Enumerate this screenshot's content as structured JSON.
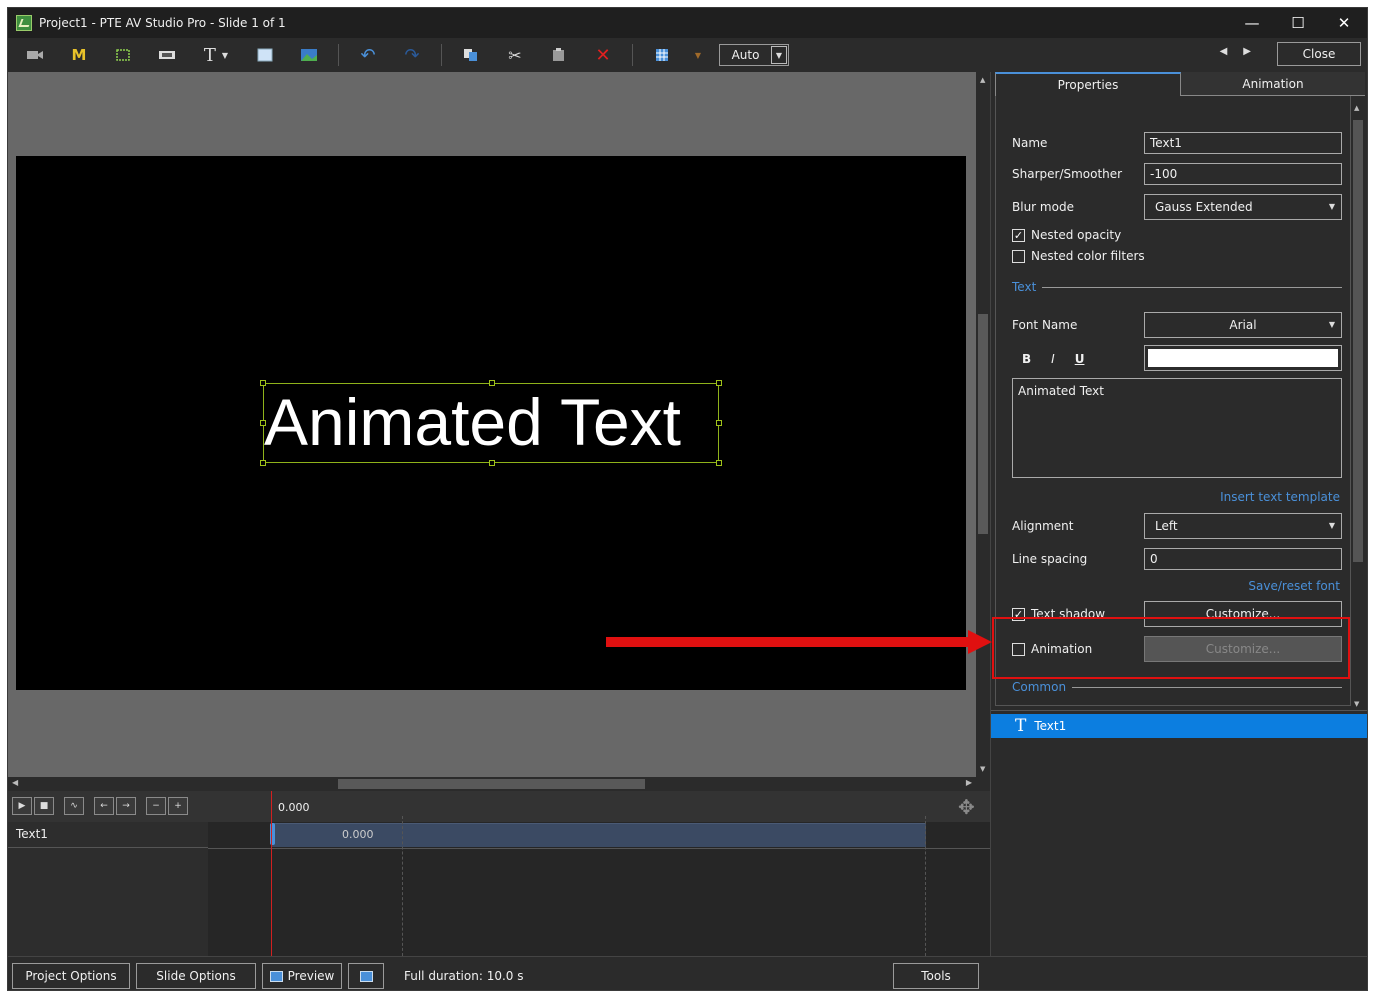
{
  "window": {
    "title": "Project1 - PTE AV Studio Pro - Slide 1 of 1",
    "minimize_glyph": "—",
    "maximize_glyph": "☐",
    "close_glyph": "✕"
  },
  "toolbar": {
    "text_tool_label": "T",
    "mask_tool_label": "M",
    "zoom_value": "Auto",
    "close_label": "Close"
  },
  "canvas": {
    "text_object": "Animated Text"
  },
  "tabs": {
    "properties": "Properties",
    "animation": "Animation"
  },
  "properties": {
    "name_label": "Name",
    "name_value": "Text1",
    "sharper_label": "Sharper/Smoother",
    "sharper_value": "-100",
    "blur_label": "Blur mode",
    "blur_value": "Gauss Extended",
    "nested_opacity_label": "Nested opacity",
    "nested_opacity_checked": true,
    "nested_color_label": "Nested color filters",
    "nested_color_checked": false,
    "text_section": "Text",
    "font_name_label": "Font Name",
    "font_name_value": "Arial",
    "bold_label": "B",
    "italic_label": "I",
    "underline_label": "U",
    "text_color": "#ffffff",
    "text_content": "Animated Text",
    "insert_template_link": "Insert text template",
    "alignment_label": "Alignment",
    "alignment_value": "Left",
    "line_spacing_label": "Line spacing",
    "line_spacing_value": "0",
    "save_reset_font_link": "Save/reset font",
    "text_shadow_label": "Text shadow",
    "text_shadow_checked": true,
    "text_shadow_customize": "Customize...",
    "animation_label": "Animation",
    "animation_checked": false,
    "animation_customize": "Customize...",
    "common_section": "Common"
  },
  "objects_list": {
    "items": [
      {
        "label": "Text1",
        "selected": true
      }
    ]
  },
  "timeline": {
    "ruler_time": "0.000",
    "track_label": "Text1",
    "bar_time": "0.000"
  },
  "statusbar": {
    "project_options": "Project Options",
    "slide_options": "Slide Options",
    "preview": "Preview",
    "full_duration": "Full duration: 10.0 s",
    "tools": "Tools"
  },
  "colors": {
    "accent": "#4a90d9",
    "selection": "#0c7ee0",
    "highlight": "#e01010",
    "object_frame": "#8fb21a"
  }
}
